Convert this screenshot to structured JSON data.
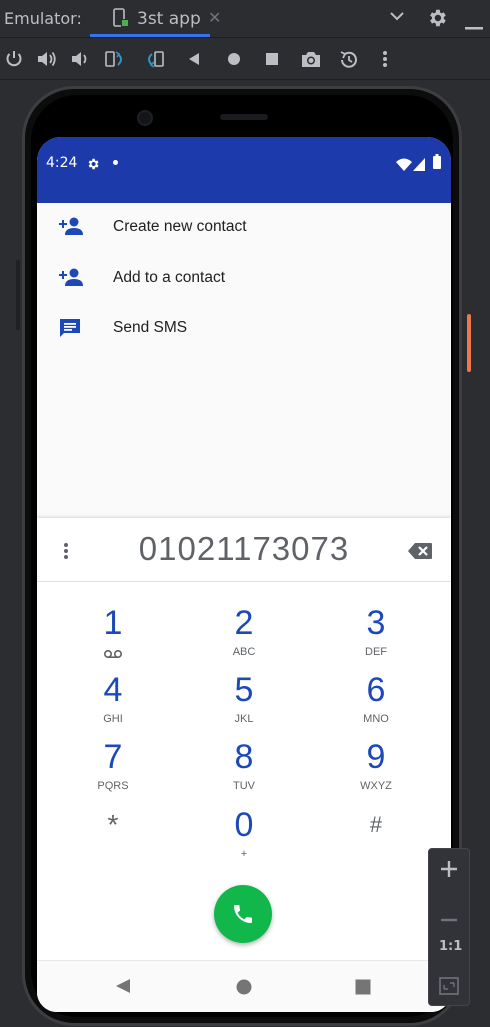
{
  "ide": {
    "emulator_label": "Emulator:",
    "tab_label": "3st app"
  },
  "status": {
    "time": "4:24"
  },
  "suggestions": [
    {
      "label": "Create new contact",
      "icon": "add-person-icon"
    },
    {
      "label": "Add to a contact",
      "icon": "add-person-icon"
    },
    {
      "label": "Send SMS",
      "icon": "message-icon"
    }
  ],
  "dialpad": {
    "number": "01021173073",
    "keys": [
      {
        "digit": "1",
        "letters": ""
      },
      {
        "digit": "2",
        "letters": "ABC"
      },
      {
        "digit": "3",
        "letters": "DEF"
      },
      {
        "digit": "4",
        "letters": "GHI"
      },
      {
        "digit": "5",
        "letters": "JKL"
      },
      {
        "digit": "6",
        "letters": "MNO"
      },
      {
        "digit": "7",
        "letters": "PQRS"
      },
      {
        "digit": "8",
        "letters": "TUV"
      },
      {
        "digit": "9",
        "letters": "WXYZ"
      },
      {
        "digit": "*",
        "letters": ""
      },
      {
        "digit": "0",
        "letters": "+"
      },
      {
        "digit": "#",
        "letters": ""
      }
    ]
  },
  "zoom": {
    "ratio_label": "1:1"
  },
  "colors": {
    "accent": "#1c3aa9",
    "digit_blue": "#1c48b8",
    "call_green": "#12b74c"
  }
}
